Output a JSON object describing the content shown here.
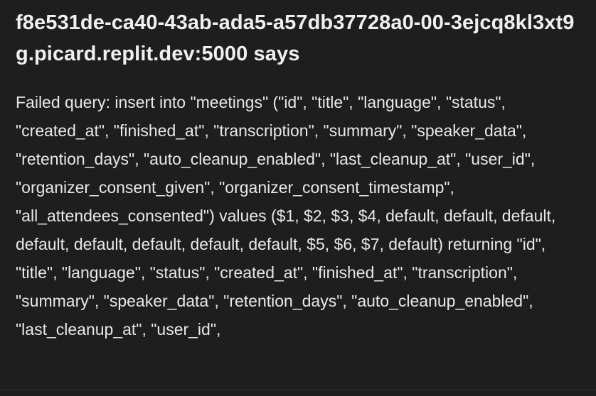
{
  "dialog": {
    "title": "f8e531de-ca40-43ab-ada5-a57db37728a0-00-3ejcq8kl3xt9g.picard.replit.dev:5000 says",
    "message": "Failed query: insert into \"meetings\" (\"id\", \"title\", \"language\", \"status\", \"created_at\", \"finished_at\", \"transcription\", \"summary\", \"speaker_data\", \"retention_days\", \"auto_cleanup_enabled\", \"last_cleanup_at\", \"user_id\", \"organizer_consent_given\", \"organizer_consent_timestamp\", \"all_attendees_consented\") values ($1, $2, $3, $4, default, default, default, default, default, default, default, default, $5, $6, $7, default) returning \"id\", \"title\", \"language\", \"status\", \"created_at\", \"finished_at\", \"transcription\", \"summary\", \"speaker_data\", \"retention_days\", \"auto_cleanup_enabled\", \"last_cleanup_at\", \"user_id\","
  },
  "colors": {
    "background": "#1e1e1e",
    "text": "#ececec"
  }
}
